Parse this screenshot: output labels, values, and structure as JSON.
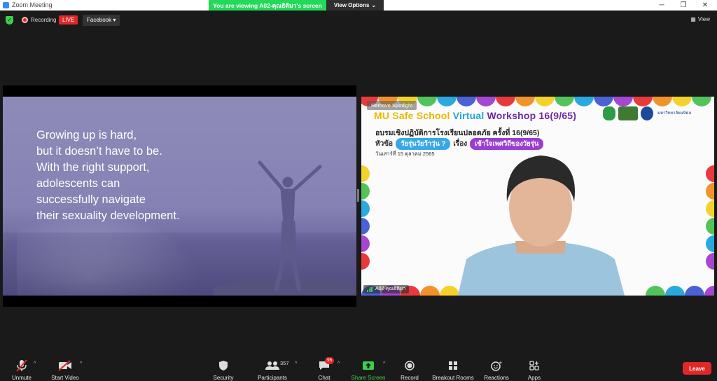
{
  "window": {
    "title": "Zoom Meeting",
    "viewing_banner": "You are viewing A02-คุณธิติมา's screen",
    "view_options": "View Options"
  },
  "status": {
    "recording_label": "Recording",
    "live_label": "LIVE",
    "stream_target": "Facebook",
    "view_label": "View"
  },
  "shared_slide": {
    "lines": [
      "Growing up is hard,",
      "but it doesn’t have to be.",
      "With the right support,",
      "adolescents can",
      "successfully navigate",
      "their sexuality development."
    ]
  },
  "spotlight_video": {
    "remove_spotlight_label": "Remove Spotlight",
    "workshop_title_mu": "MU",
    "workshop_title_safe": "Safe School",
    "workshop_title_virtual": "Virtual",
    "workshop_title_rest": "Workshop 16(9/65)",
    "thai_line1": "อบรมเชิงปฏิบัติการโรงเรียนปลอดภัย ครั้งที่ 16(9/65)",
    "thai_topic_label": "หัวข้อ",
    "thai_topic_pill": "วัยรุ่นวัยว้าวุ่น ?",
    "thai_subject_label": "เรื่อง",
    "thai_subject_pill": "เข้าใจเพศวิถีของวัยรุ่น",
    "thai_date": "วันเสาร์ที่ 15 ตุลาคม 2565",
    "university_name": "มหาวิทยาลัยมหิดล",
    "participant_name": "A02-คุณธิติมา"
  },
  "toolbar": {
    "unmute": "Unmute",
    "start_video": "Start Video",
    "security": "Security",
    "participants": "Participants",
    "participants_count": "357",
    "chat": "Chat",
    "chat_badge": "96",
    "share_screen": "Share Screen",
    "record": "Record",
    "breakout_rooms": "Breakout Rooms",
    "reactions": "Reactions",
    "apps": "Apps",
    "leave": "Leave"
  },
  "colors": {
    "accent_green": "#23d959",
    "live_red": "#e02828",
    "zoom_blue": "#2d8cff",
    "slide_purple": "#8682b4"
  }
}
